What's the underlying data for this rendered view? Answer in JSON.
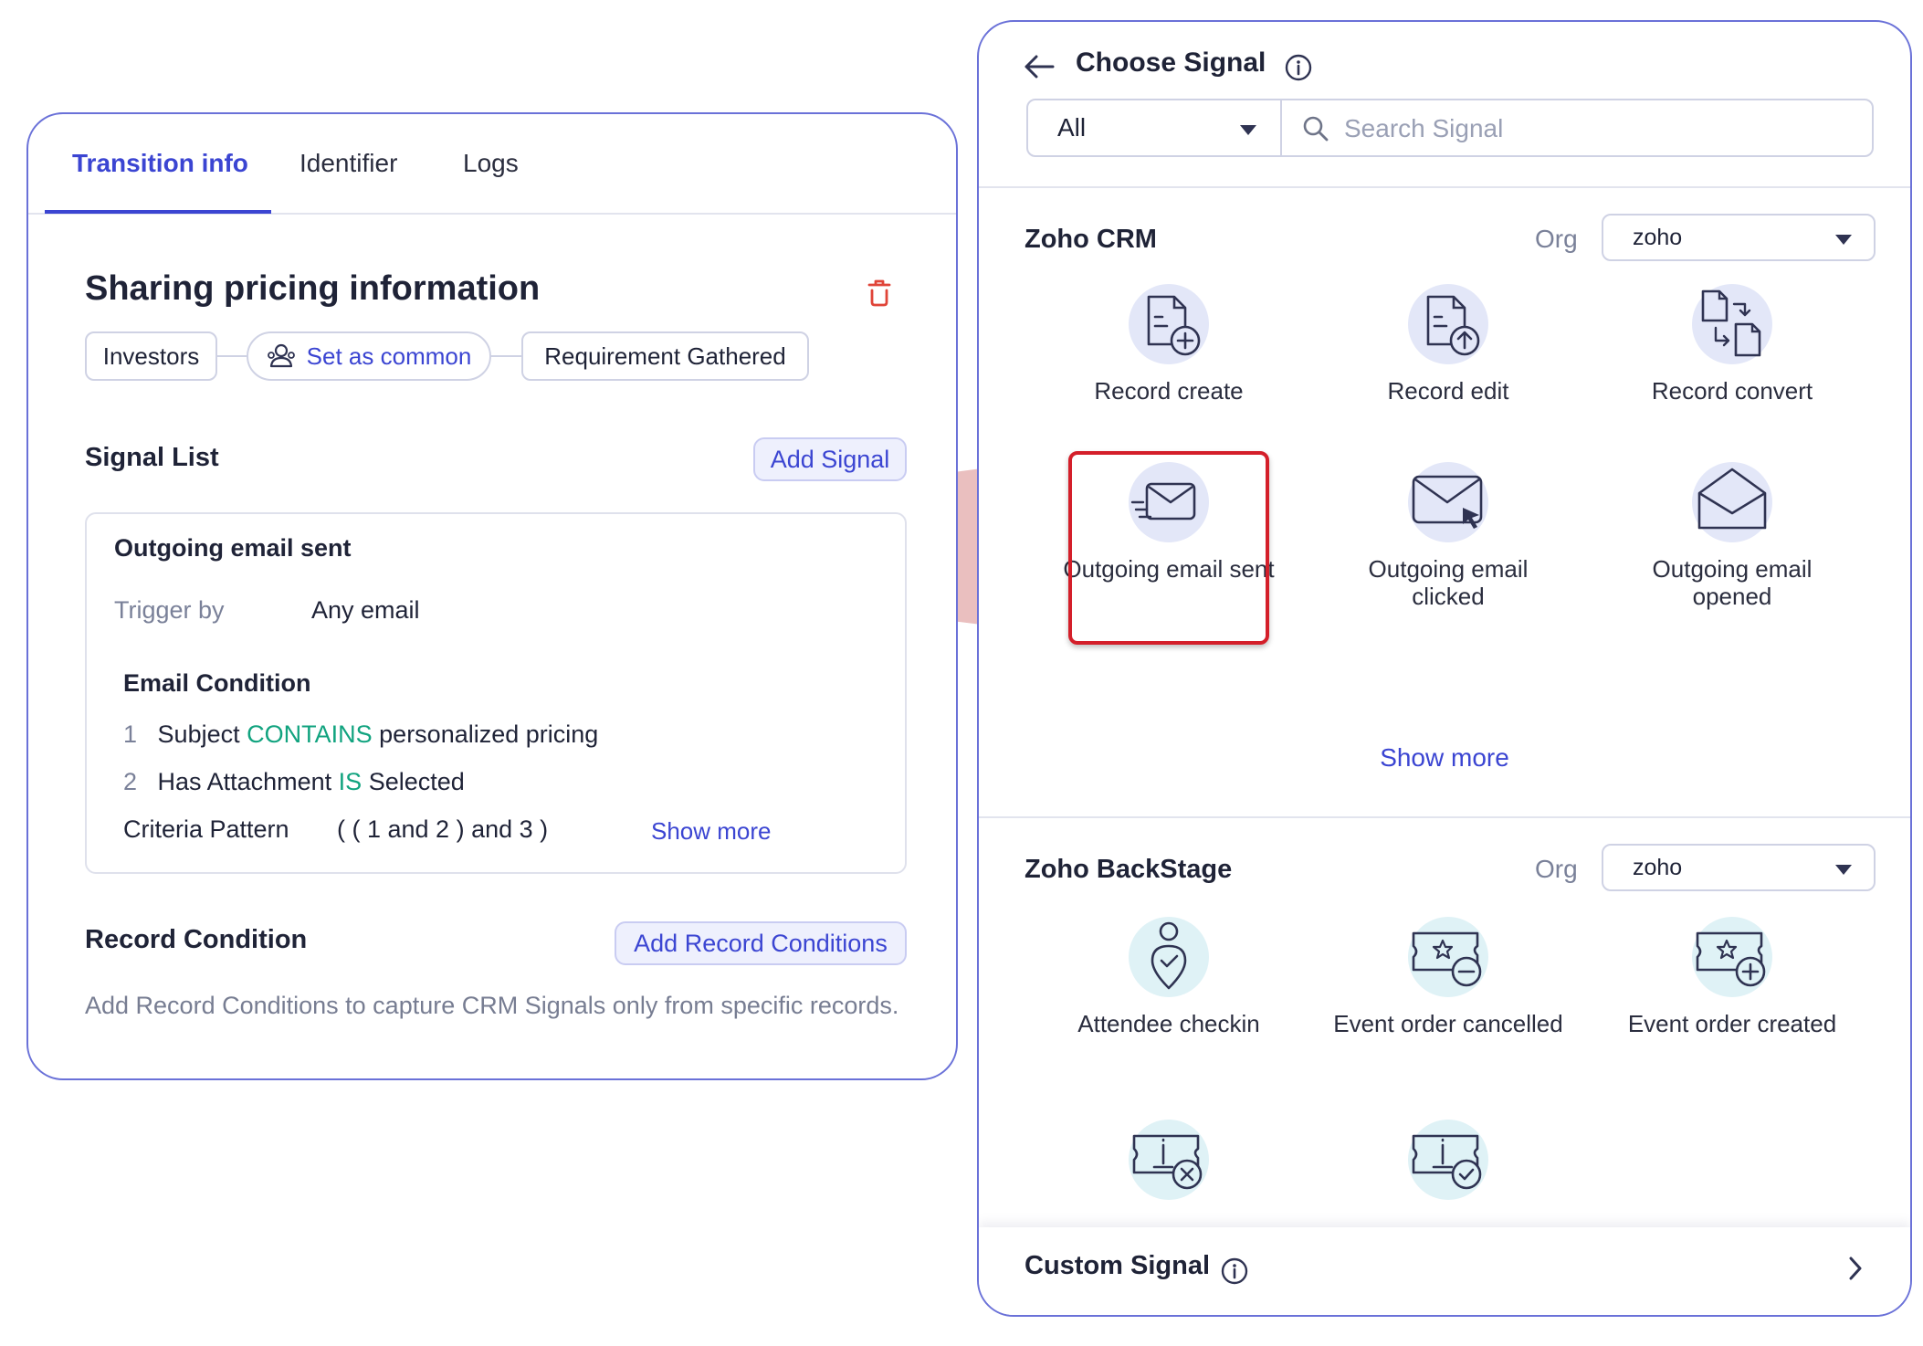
{
  "left": {
    "tabs": [
      {
        "label": "Transition info"
      },
      {
        "label": "Identifier"
      },
      {
        "label": "Logs"
      }
    ],
    "title": "Sharing pricing information",
    "chips": {
      "first": "Investors",
      "common": "Set as common",
      "last": "Requirement Gathered"
    },
    "signal_list": {
      "heading": "Signal List",
      "add_button": "Add Signal",
      "card": {
        "name": "Outgoing email sent",
        "trigger_label": "Trigger by",
        "trigger_value": "Any email",
        "condition_heading": "Email Condition",
        "conditions": [
          {
            "num": "1",
            "field": "Subject",
            "op": "CONTAINS",
            "value": "personalized pricing"
          },
          {
            "num": "2",
            "field": "Has Attachment",
            "op": "IS",
            "value": "Selected"
          }
        ],
        "pattern_label": "Criteria Pattern",
        "pattern_value": "( ( 1 and 2 ) and 3 )",
        "show_more": "Show more"
      }
    },
    "record_condition": {
      "heading": "Record Condition",
      "add_button": "Add Record Conditions",
      "description": "Add Record Conditions to capture CRM Signals only from specific records."
    }
  },
  "right": {
    "title": "Choose Signal",
    "filter": {
      "selected": "All"
    },
    "search": {
      "placeholder": "Search Signal"
    },
    "groups": [
      {
        "title": "Zoho CRM",
        "org_label": "Org",
        "org_value": "zoho",
        "items": [
          {
            "label": "Record create",
            "icon": "record-create-icon"
          },
          {
            "label": "Record edit",
            "icon": "record-edit-icon"
          },
          {
            "label": "Record convert",
            "icon": "record-convert-icon"
          },
          {
            "label": "Outgoing email sent",
            "icon": "email-sent-icon"
          },
          {
            "label": "Outgoing email clicked",
            "icon": "email-clicked-icon"
          },
          {
            "label": "Outgoing email opened",
            "icon": "email-opened-icon"
          }
        ],
        "show_more": "Show more"
      },
      {
        "title": "Zoho BackStage",
        "org_label": "Org",
        "org_value": "zoho",
        "items": [
          {
            "label": "Attendee checkin",
            "icon": "attendee-checkin-icon"
          },
          {
            "label": "Event order cancelled",
            "icon": "event-cancelled-icon"
          },
          {
            "label": "Event order created",
            "icon": "event-created-icon"
          },
          {
            "label": "",
            "icon": "ticket-cancel-icon"
          },
          {
            "label": "",
            "icon": "ticket-approve-icon"
          }
        ]
      }
    ],
    "custom_signal": {
      "title": "Custom Signal"
    }
  },
  "colors": {
    "accent": "#3b45d2",
    "panel_border": "#6a71d8",
    "highlight_red": "#d41f2a",
    "callout_fill": "#e9bcbc",
    "icon_bg_blue": "#e3e7f8",
    "icon_bg_teal": "#dff2f6",
    "condition_operator": "#11a37f"
  }
}
